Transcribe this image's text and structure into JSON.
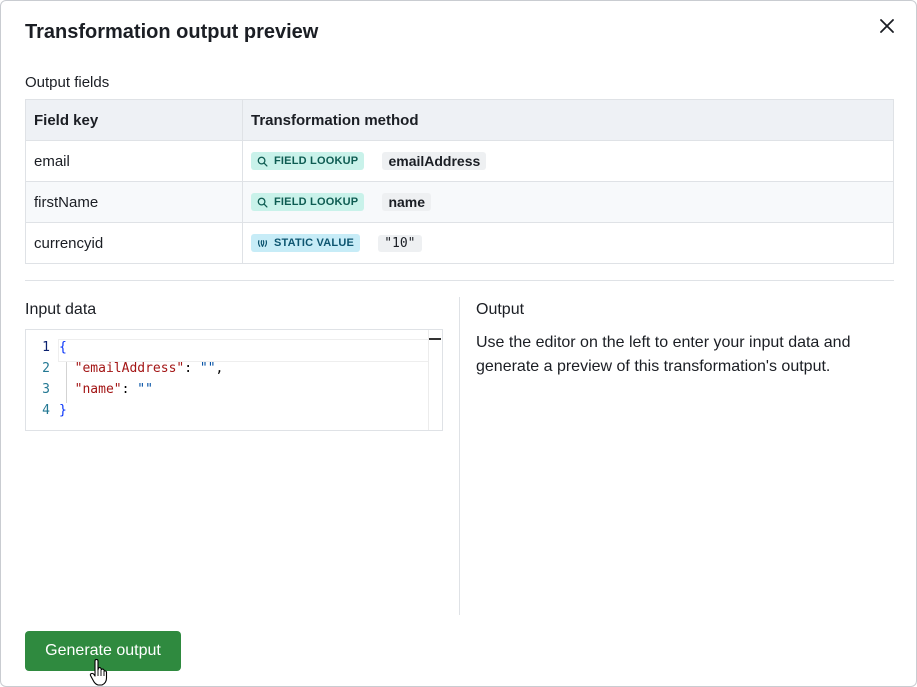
{
  "dialog": {
    "title": "Transformation output preview",
    "close_icon": "close-icon"
  },
  "output_fields": {
    "label": "Output fields",
    "headers": [
      "Field key",
      "Transformation method"
    ],
    "rows": [
      {
        "key": "email",
        "method": "FIELD LOOKUP",
        "method_icon": "search-icon",
        "value": "emailAddress"
      },
      {
        "key": "firstName",
        "method": "FIELD LOOKUP",
        "method_icon": "search-icon",
        "value": "name"
      },
      {
        "key": "currencyid",
        "method": "STATIC VALUE",
        "method_icon": "quote-icon",
        "value": "\"10\""
      }
    ]
  },
  "input_data": {
    "label": "Input data",
    "line_numbers": [
      "1",
      "2",
      "3",
      "4"
    ],
    "lines": {
      "l1_brace": "{",
      "l2_key": "\"emailAddress\"",
      "l2_sep": ": ",
      "l2_val": "\"\"",
      "l2_comma": ",",
      "l3_key": "\"name\"",
      "l3_sep": ": ",
      "l3_val": "\"\"",
      "l4_brace": "}"
    }
  },
  "output": {
    "label": "Output",
    "description": "Use the editor on the left to enter your input data and generate a preview of this transformation's output."
  },
  "actions": {
    "generate_label": "Generate output"
  },
  "colors": {
    "primary_button": "#2f8a3f",
    "lookup_tag_bg": "#c9f2ea",
    "static_tag_bg": "#c7ecf7"
  }
}
